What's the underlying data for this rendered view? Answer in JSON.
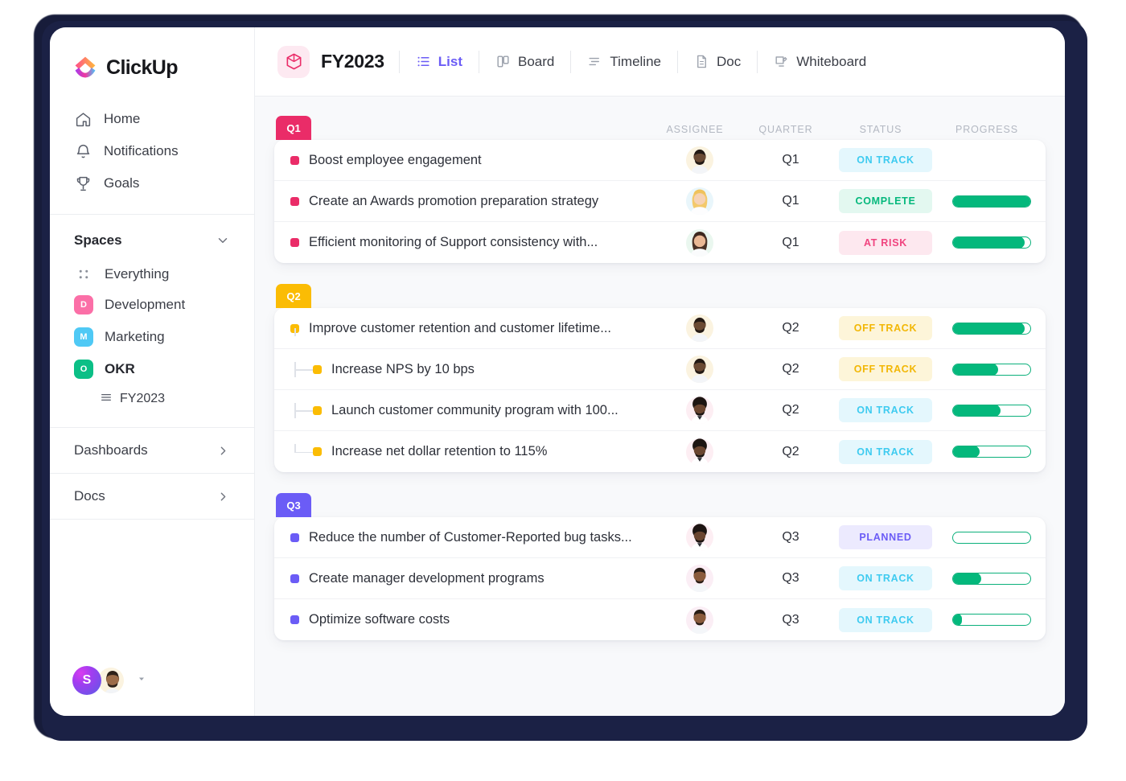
{
  "sidebar": {
    "brand": "ClickUp",
    "nav": [
      {
        "label": "Home",
        "icon": "home-icon"
      },
      {
        "label": "Notifications",
        "icon": "bell-icon"
      },
      {
        "label": "Goals",
        "icon": "trophy-icon"
      }
    ],
    "spaces_title": "Spaces",
    "spaces": [
      {
        "label": "Everything",
        "icon": "grid-dots-icon",
        "badge": "",
        "color": "",
        "bold": false
      },
      {
        "label": "Development",
        "icon": "space-badge",
        "badge": "D",
        "color": "#fb6fa7",
        "bold": false
      },
      {
        "label": "Marketing",
        "icon": "space-badge",
        "badge": "M",
        "color": "#4fc9f5",
        "bold": false
      },
      {
        "label": "OKR",
        "icon": "space-badge",
        "badge": "O",
        "color": "#0bbf86",
        "bold": true
      }
    ],
    "sub_item": {
      "label": "FY2023",
      "icon": "list-lines-icon"
    },
    "sections": [
      {
        "label": "Dashboards",
        "icon": "chevron-right-icon"
      },
      {
        "label": "Docs",
        "icon": "chevron-right-icon"
      }
    ],
    "footer": {
      "workspace_initial": "S",
      "avatar": "user-avatar",
      "caret": "caret-down-icon"
    }
  },
  "topbar": {
    "view_title": "FY2023",
    "list_icon": "cube-icon",
    "tabs": [
      {
        "label": "List",
        "icon": "list-icon",
        "active": true
      },
      {
        "label": "Board",
        "icon": "board-icon",
        "active": false
      },
      {
        "label": "Timeline",
        "icon": "timeline-icon",
        "active": false
      },
      {
        "label": "Doc",
        "icon": "doc-icon",
        "active": false
      },
      {
        "label": "Whiteboard",
        "icon": "whiteboard-icon",
        "active": false
      }
    ]
  },
  "columns": {
    "assignee": "ASSIGNEE",
    "quarter": "QUARTER",
    "status": "STATUS",
    "progress": "PROGRESS"
  },
  "status_colors": {
    "ON TRACK": {
      "fg": "#3ecbf0",
      "bg": "#e4f7fd"
    },
    "COMPLETE": {
      "fg": "#04b87c",
      "bg": "#e3f8f0"
    },
    "AT RISK": {
      "fg": "#f0447f",
      "bg": "#fde8ef"
    },
    "OFF TRACK": {
      "fg": "#f2b705",
      "bg": "#fdf5d9"
    },
    "PLANNED": {
      "fg": "#6b5cf6",
      "bg": "#eceafe"
    }
  },
  "groups": [
    {
      "label": "Q1",
      "color": "#ea2c68",
      "bullet": "#ea2c68",
      "show_headers": true,
      "tasks": [
        {
          "title": "Boost employee engagement",
          "quarter": "Q1",
          "status": "ON TRACK",
          "progress": 0,
          "show_progress": false,
          "nested": false,
          "avatar": "male-beard-dark"
        },
        {
          "title": "Create an Awards promotion preparation strategy",
          "quarter": "Q1",
          "status": "COMPLETE",
          "progress": 100,
          "show_progress": true,
          "nested": false,
          "avatar": "female-blonde"
        },
        {
          "title": "Efficient monitoring of Support consistency with...",
          "quarter": "Q1",
          "status": "AT RISK",
          "progress": 92,
          "show_progress": true,
          "nested": false,
          "avatar": "female-brunette"
        }
      ]
    },
    {
      "label": "Q2",
      "color": "#fbbc04",
      "bullet": "#fbbc04",
      "show_headers": false,
      "tasks": [
        {
          "title": "Improve customer retention and customer lifetime...",
          "quarter": "Q2",
          "status": "OFF TRACK",
          "progress": 92,
          "show_progress": true,
          "nested": false,
          "avatar": "male-beard-dark"
        },
        {
          "title": "Increase NPS by 10 bps",
          "quarter": "Q2",
          "status": "OFF TRACK",
          "progress": 57,
          "show_progress": true,
          "nested": true,
          "avatar": "male-beard-dark"
        },
        {
          "title": "Launch customer community program with 100...",
          "quarter": "Q2",
          "status": "ON TRACK",
          "progress": 60,
          "show_progress": true,
          "nested": true,
          "avatar": "male-afro"
        },
        {
          "title": "Increase net dollar retention to 115%",
          "quarter": "Q2",
          "status": "ON TRACK",
          "progress": 33,
          "show_progress": true,
          "nested": true,
          "avatar": "male-afro"
        }
      ]
    },
    {
      "label": "Q3",
      "color": "#6b5cf6",
      "bullet": "#6b5cf6",
      "show_headers": false,
      "tasks": [
        {
          "title": "Reduce the number of Customer-Reported bug tasks...",
          "quarter": "Q3",
          "status": "PLANNED",
          "progress": 0,
          "show_progress": true,
          "nested": false,
          "avatar": "male-afro"
        },
        {
          "title": "Create manager development programs",
          "quarter": "Q3",
          "status": "ON TRACK",
          "progress": 35,
          "show_progress": true,
          "nested": false,
          "avatar": "male-smile"
        },
        {
          "title": "Optimize software costs",
          "quarter": "Q3",
          "status": "ON TRACK",
          "progress": 10,
          "show_progress": true,
          "nested": false,
          "avatar": "male-smile"
        }
      ]
    }
  ]
}
